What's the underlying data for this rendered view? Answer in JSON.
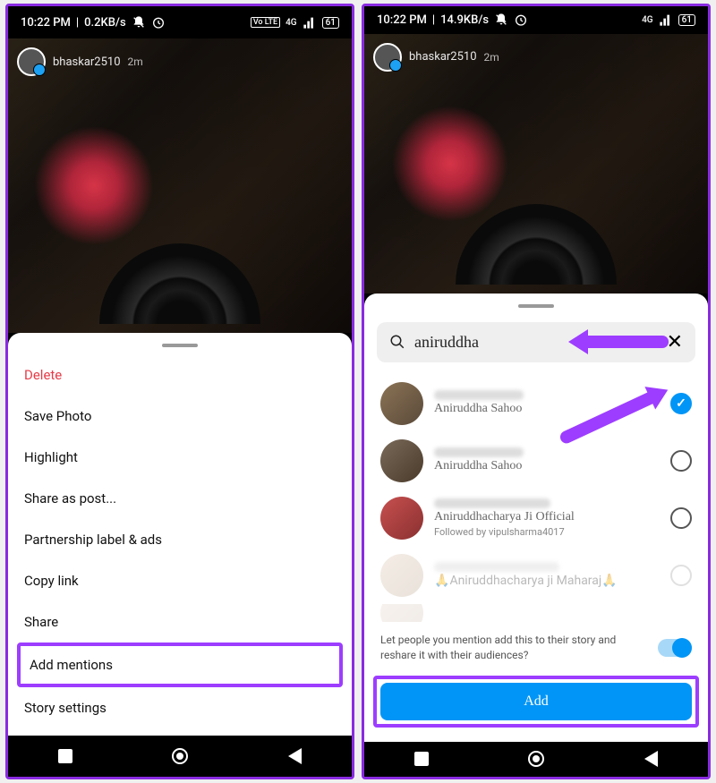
{
  "status": {
    "time": "10:22 PM",
    "speed_left": "0.2KB/s",
    "speed_right": "14.9KB/s",
    "network": "4G",
    "volte": "Vo LTE",
    "battery": "61"
  },
  "story": {
    "username": "bhaskar2510",
    "time_ago": "2m"
  },
  "menu": {
    "delete": "Delete",
    "save_photo": "Save Photo",
    "highlight": "Highlight",
    "share_as_post": "Share as post...",
    "partnership": "Partnership label & ads",
    "copy_link": "Copy link",
    "share": "Share",
    "add_mentions": "Add mentions",
    "story_settings": "Story settings"
  },
  "search": {
    "query": "aniruddha"
  },
  "users": [
    {
      "name": "Aniruddha Sahoo",
      "selected": true
    },
    {
      "name": "Aniruddha Sahoo",
      "selected": false
    },
    {
      "name": "Aniruddhacharya Ji Official",
      "followed_by": "Followed by vipulsharma4017",
      "selected": false
    },
    {
      "name": "Aniruddhacharya ji Maharaj",
      "selected": false,
      "faded": true,
      "emoji": "🙏"
    }
  ],
  "toggle": {
    "text": "Let people you mention add this to their story and reshare it with their audiences?"
  },
  "add_button": "Add"
}
